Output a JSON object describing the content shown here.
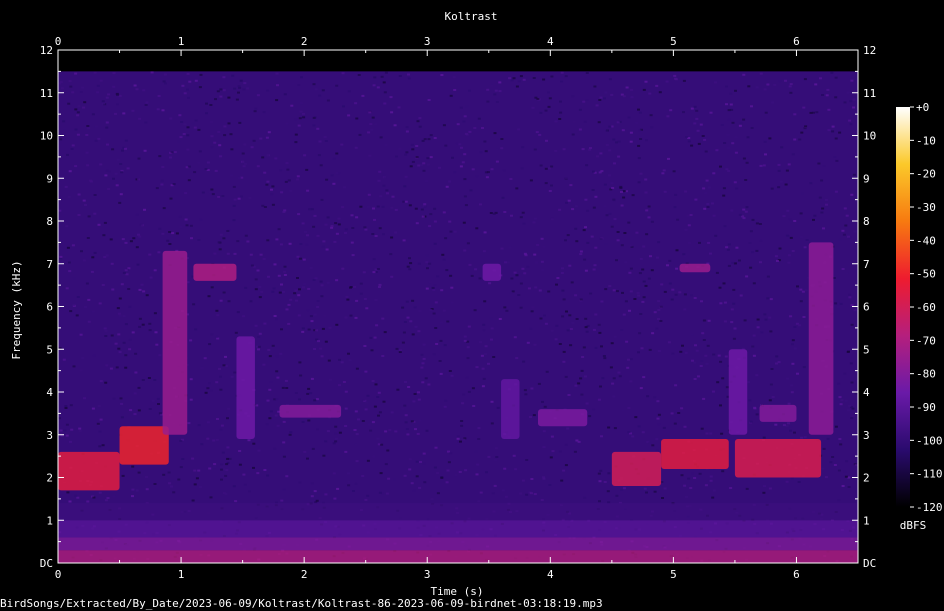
{
  "chart_data": {
    "type": "heatmap",
    "title": "Koltrast",
    "xlabel": "Time (s)",
    "ylabel": "Frequency (kHz)",
    "xlim": [
      0,
      6.5
    ],
    "ylim": [
      0,
      12
    ],
    "x_ticks": [
      "0",
      "1",
      "2",
      "3",
      "4",
      "5",
      "6"
    ],
    "y_ticks": [
      "DC",
      "1",
      "2",
      "3",
      "4",
      "5",
      "6",
      "7",
      "8",
      "9",
      "10",
      "11",
      "12"
    ],
    "colorbar": {
      "unit": "dBFS",
      "range": [
        -120,
        0
      ],
      "ticks": [
        "+0",
        "-10",
        "-20",
        "-30",
        "-40",
        "-50",
        "-60",
        "-70",
        "-80",
        "-90",
        "-100",
        "-110",
        "-120"
      ],
      "colors": [
        "#000000",
        "#2a0b6e",
        "#6a1aa8",
        "#b51f7d",
        "#ee1c2f",
        "#f77a10",
        "#fbc92a",
        "#ffffff"
      ]
    },
    "max_frequency_shown_khz": 11.5,
    "events": [
      {
        "t0": 0.0,
        "t1": 0.5,
        "f0": 1.7,
        "f1": 2.6,
        "level_db": -55
      },
      {
        "t0": 0.5,
        "t1": 0.9,
        "f0": 2.3,
        "f1": 3.2,
        "level_db": -50
      },
      {
        "t0": 0.85,
        "t1": 1.05,
        "f0": 3.0,
        "f1": 7.3,
        "level_db": -75
      },
      {
        "t0": 1.1,
        "t1": 1.45,
        "f0": 6.6,
        "f1": 7.0,
        "level_db": -70
      },
      {
        "t0": 1.45,
        "t1": 1.6,
        "f0": 2.9,
        "f1": 5.3,
        "level_db": -85
      },
      {
        "t0": 1.8,
        "t1": 2.3,
        "f0": 3.4,
        "f1": 3.7,
        "level_db": -80
      },
      {
        "t0": 3.45,
        "t1": 3.6,
        "f0": 6.6,
        "f1": 7.0,
        "level_db": -85
      },
      {
        "t0": 3.6,
        "t1": 3.75,
        "f0": 2.9,
        "f1": 4.3,
        "level_db": -88
      },
      {
        "t0": 3.9,
        "t1": 4.3,
        "f0": 3.2,
        "f1": 3.6,
        "level_db": -82
      },
      {
        "t0": 4.5,
        "t1": 4.9,
        "f0": 1.8,
        "f1": 2.6,
        "level_db": -60
      },
      {
        "t0": 4.9,
        "t1": 5.45,
        "f0": 2.2,
        "f1": 2.9,
        "level_db": -55
      },
      {
        "t0": 5.05,
        "t1": 5.3,
        "f0": 6.8,
        "f1": 7.0,
        "level_db": -75
      },
      {
        "t0": 5.45,
        "t1": 5.6,
        "f0": 3.0,
        "f1": 5.0,
        "level_db": -85
      },
      {
        "t0": 5.5,
        "t1": 6.2,
        "f0": 2.0,
        "f1": 2.9,
        "level_db": -58
      },
      {
        "t0": 5.7,
        "t1": 6.0,
        "f0": 3.3,
        "f1": 3.7,
        "level_db": -80
      },
      {
        "t0": 6.1,
        "t1": 6.3,
        "f0": 3.0,
        "f1": 7.5,
        "level_db": -78
      }
    ]
  },
  "footer": {
    "file_path": "BirdSongs/Extracted/By_Date/2023-06-09/Koltrast/Koltrast-86-2023-06-09-birdnet-03:18:19.mp3"
  }
}
